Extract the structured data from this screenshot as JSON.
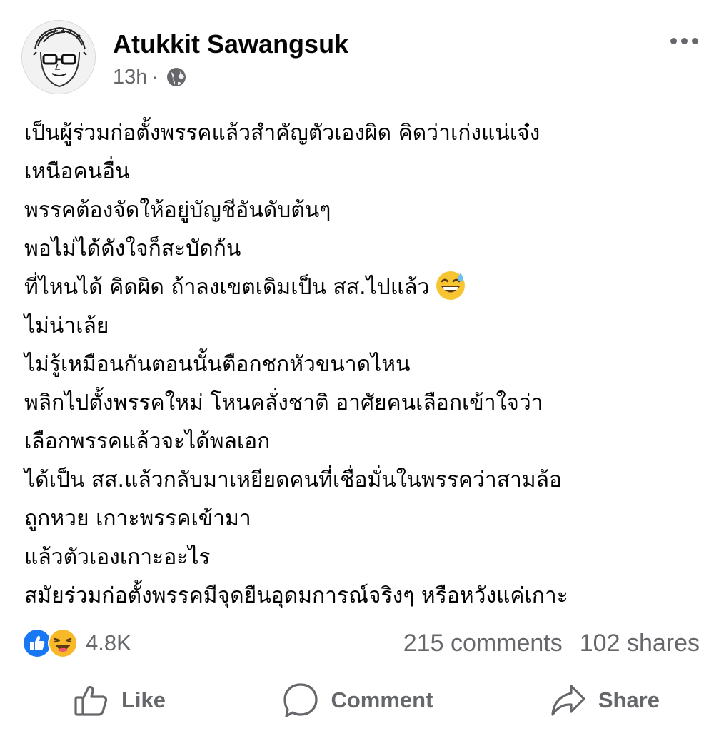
{
  "post": {
    "author": "Atukkit Sawangsuk",
    "time": "13h",
    "separator": "·",
    "privacy_icon": "globe-icon",
    "more_icon": "more-options-icon",
    "lines": [
      "เป็นผู้ร่วมก่อตั้งพรรคแล้วสำคัญตัวเองผิด คิดว่าเก่งแน่เจ๋ง",
      "เหนือคนอื่น",
      "พรรคต้องจัดให้อยู่บัญชีอันดับต้นๆ",
      "พอไม่ได้ดังใจก็สะบัดก้น",
      "ที่ไหนได้ คิดผิด ถ้าลงเขตเดิมเป็น สส.ไปแล้ว",
      "ไม่น่าเล้ย",
      "ไม่รู้เหมือนกันตอนนั้นตือกชกหัวขนาดไหน",
      "พลิกไปตั้งพรรคใหม่ โหนคลั่งชาติ อาศัยคนเลือกเข้าใจว่า",
      "เลือกพรรคแล้วจะได้พลเอก",
      "ได้เป็น สส.แล้วกลับมาเหยียดคนที่เชื่อมั่นในพรรคว่าสามล้อ",
      "ถูกหวย เกาะพรรคเข้ามา",
      "แล้วตัวเองเกาะอะไร",
      "สมัยร่วมก่อตั้งพรรคมีจุดยืนอุดมการณ์จริงๆ หรือหวังแค่เกาะ"
    ],
    "emoji_icon": "grinning-sweat-emoji"
  },
  "stats": {
    "reaction_icons": [
      "like-reaction-icon",
      "haha-reaction-icon"
    ],
    "reactions": "4.8K",
    "comments": "215 comments",
    "shares": "102 shares"
  },
  "actions": {
    "like": "Like",
    "comment": "Comment",
    "share": "Share"
  },
  "colors": {
    "text": "#050505",
    "secondary": "#65676b",
    "like_blue": "#1877f2",
    "emoji_yellow": "#f7b928"
  }
}
